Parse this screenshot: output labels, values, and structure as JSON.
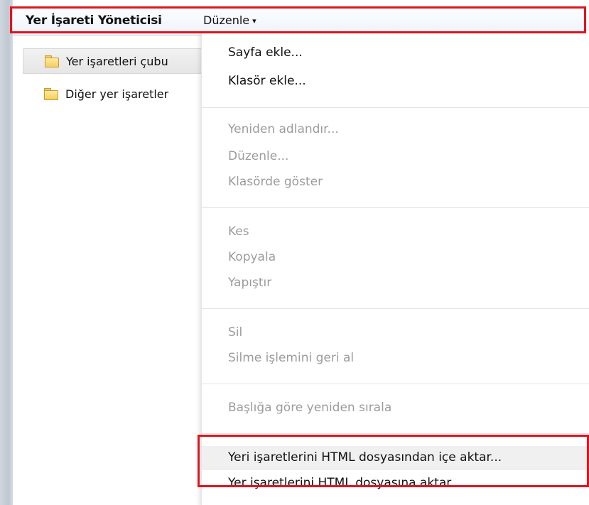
{
  "header": {
    "title": "Yer İşareti Yöneticisi",
    "menu_label": "Düzenle",
    "menu_arrow": "▾"
  },
  "tree": {
    "items": [
      {
        "label": "Yer işaretleri çubu",
        "icon": "folder-icon",
        "selected": true
      },
      {
        "label": "Diğer yer işaretler",
        "icon": "folder-icon",
        "selected": false
      }
    ]
  },
  "menu": {
    "groups": [
      [
        {
          "label": "Sayfa ekle...",
          "enabled": true
        },
        {
          "label": "Klasör ekle...",
          "enabled": true
        }
      ],
      [
        {
          "label": "Yeniden adlandır...",
          "enabled": false
        },
        {
          "label": "Düzenle...",
          "enabled": false
        },
        {
          "label": "Klasörde göster",
          "enabled": false
        }
      ],
      [
        {
          "label": "Kes",
          "enabled": false
        },
        {
          "label": "Kopyala",
          "enabled": false
        },
        {
          "label": "Yapıştır",
          "enabled": false
        }
      ],
      [
        {
          "label": "Sil",
          "enabled": false
        },
        {
          "label": "Silme işlemini geri al",
          "enabled": false
        }
      ],
      [
        {
          "label": "Başlığa göre yeniden sırala",
          "enabled": false
        }
      ],
      [
        {
          "label": "Yeri işaretlerini HTML dosyasından içe aktar...",
          "enabled": true,
          "highlighted": true
        },
        {
          "label": "Yer işaretlerini HTML dosyasına aktar...",
          "enabled": true
        }
      ]
    ]
  },
  "colors": {
    "annotation_red": "#e0141c",
    "disabled_text": "#9c9c9c"
  }
}
